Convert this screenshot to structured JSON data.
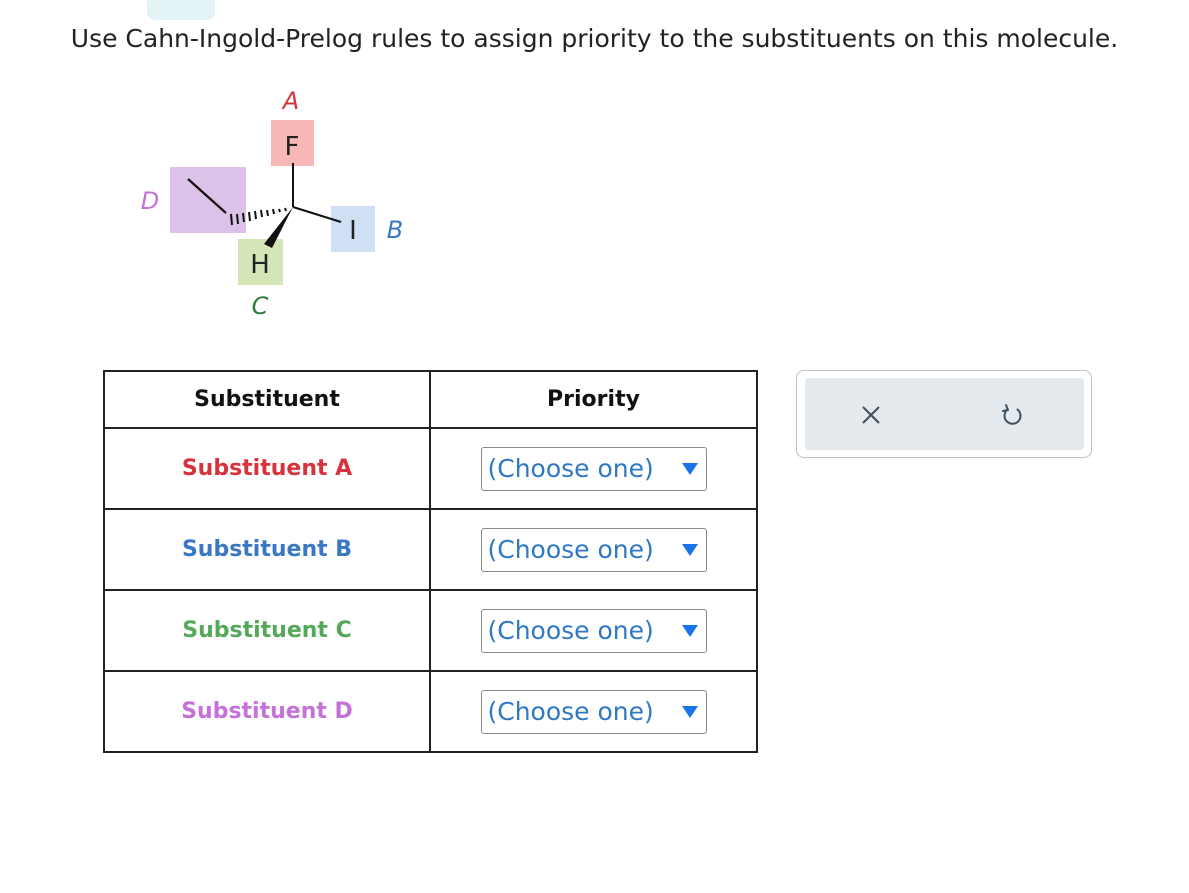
{
  "instruction": "Use Cahn-Ingold-Prelog rules to assign priority to the substituents on this molecule.",
  "molecule": {
    "labels": {
      "a": "A",
      "b": "B",
      "c": "C",
      "d": "D"
    },
    "atoms": {
      "top": "F",
      "right": "I",
      "bottom": "H"
    },
    "colors": {
      "a_label": "#d6333d",
      "a_box": "#f9b8b8",
      "b_label": "#3a78c4",
      "b_box": "#cfe0f5",
      "c_label": "#2e7d3a",
      "c_box": "#d4e5b8",
      "d_label": "#c472d8",
      "d_box": "#dcc1e8"
    }
  },
  "table": {
    "headers": {
      "substituent": "Substituent",
      "priority": "Priority"
    },
    "rows": [
      {
        "name": "Substituent A",
        "color": "#d6333d",
        "selected": "(Choose one)"
      },
      {
        "name": "Substituent B",
        "color": "#3a78c4",
        "selected": "(Choose one)"
      },
      {
        "name": "Substituent C",
        "color": "#55a85a",
        "selected": "(Choose one)"
      },
      {
        "name": "Substituent D",
        "color": "#c472d8",
        "selected": "(Choose one)"
      }
    ]
  },
  "actions": {
    "clear_icon": "close-icon",
    "reset_icon": "undo-icon"
  },
  "accent_color": "#1a73e8"
}
